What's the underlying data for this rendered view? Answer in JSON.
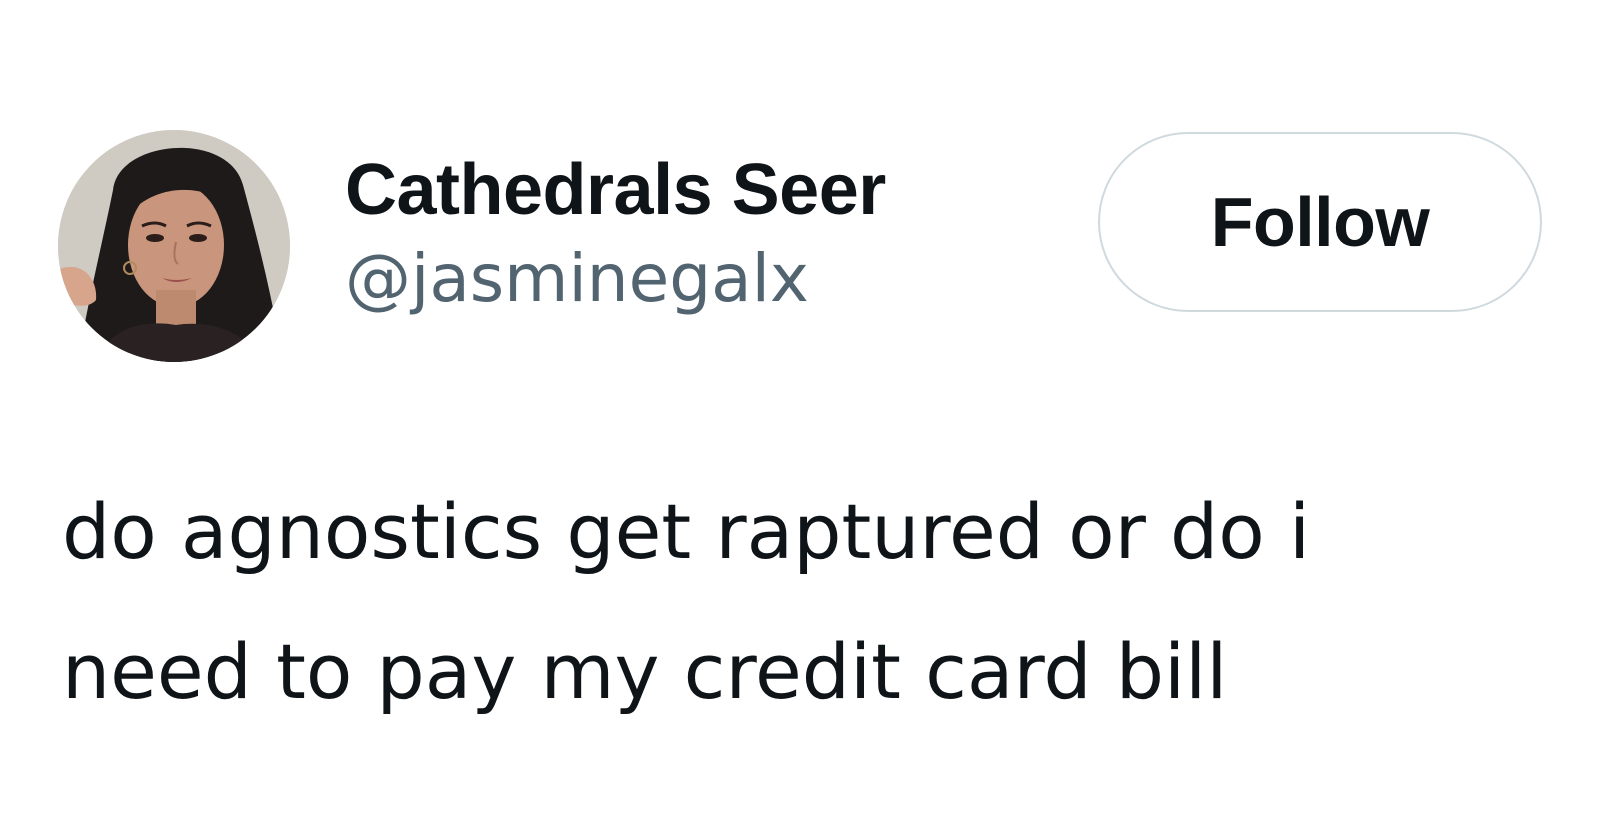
{
  "tweet": {
    "author": {
      "display_name": "Cathedrals Seer",
      "handle": "@jasminegalx",
      "avatar_icon": "profile-photo"
    },
    "follow_button": {
      "label": "Follow"
    },
    "text_lines": [
      "do agnostics get raptured or do i",
      "need to pay my credit card bill"
    ]
  },
  "colors": {
    "primary_text": "#0f1419",
    "secondary_text": "#536471",
    "button_border": "#cfd9de",
    "background": "#ffffff"
  }
}
